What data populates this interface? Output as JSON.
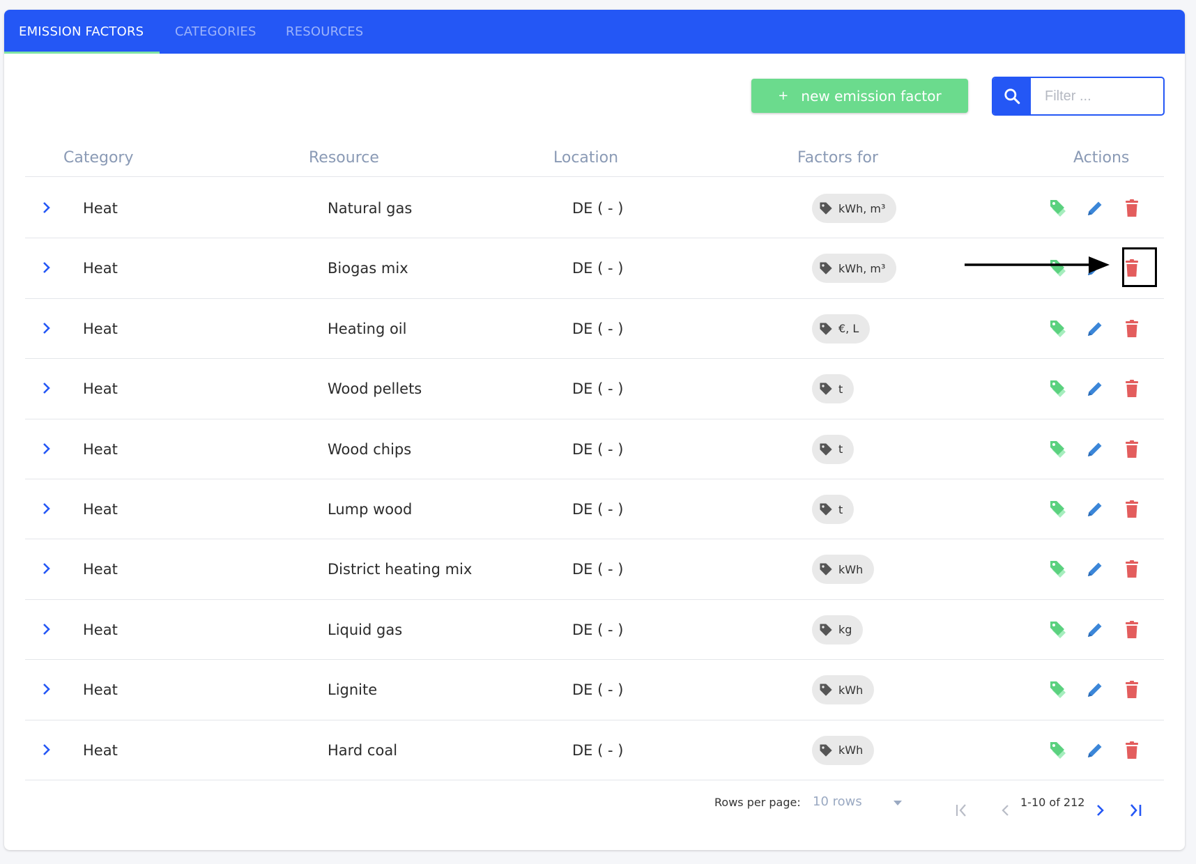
{
  "tabs": [
    {
      "label": "EMISSION FACTORS",
      "active": true
    },
    {
      "label": "CATEGORIES",
      "active": false
    },
    {
      "label": "RESOURCES",
      "active": false
    }
  ],
  "toolbar": {
    "new_button_plus": "+",
    "new_button_label": "new emission factor",
    "filter_placeholder": "Filter ..."
  },
  "table": {
    "headers": [
      "Category",
      "Resource",
      "Location",
      "Factors for",
      "Actions"
    ],
    "rows": [
      {
        "category": "Heat",
        "resource": "Natural gas",
        "location": "DE ( - )",
        "factors": "kWh, m³"
      },
      {
        "category": "Heat",
        "resource": "Biogas mix",
        "location": "DE ( - )",
        "factors": "kWh, m³"
      },
      {
        "category": "Heat",
        "resource": "Heating oil",
        "location": "DE ( - )",
        "factors": "€, L"
      },
      {
        "category": "Heat",
        "resource": "Wood pellets",
        "location": "DE ( - )",
        "factors": "t"
      },
      {
        "category": "Heat",
        "resource": "Wood chips",
        "location": "DE ( - )",
        "factors": "t"
      },
      {
        "category": "Heat",
        "resource": "Lump wood",
        "location": "DE ( - )",
        "factors": "t"
      },
      {
        "category": "Heat",
        "resource": "District heating mix",
        "location": "DE ( - )",
        "factors": "kWh"
      },
      {
        "category": "Heat",
        "resource": "Liquid gas",
        "location": "DE ( - )",
        "factors": "kg"
      },
      {
        "category": "Heat",
        "resource": "Lignite",
        "location": "DE ( - )",
        "factors": "kWh"
      },
      {
        "category": "Heat",
        "resource": "Hard coal",
        "location": "DE ( - )",
        "factors": "kWh"
      }
    ]
  },
  "footer": {
    "rows_per_page_label": "Rows per page:",
    "rows_per_page_value": "10 rows",
    "range_text": "1-10 of 212"
  },
  "icons": {
    "row_expand": "chevron-right-icon",
    "factor_chip": "tag-icon",
    "action_factors": "tags-icon",
    "action_edit": "pencil-icon",
    "action_delete": "trash-icon"
  },
  "colors": {
    "primary": "#2457f5",
    "success": "#6bdb8d",
    "edit": "#3b86d8",
    "delete": "#e35d5d",
    "header_text": "#8a9ab5"
  }
}
